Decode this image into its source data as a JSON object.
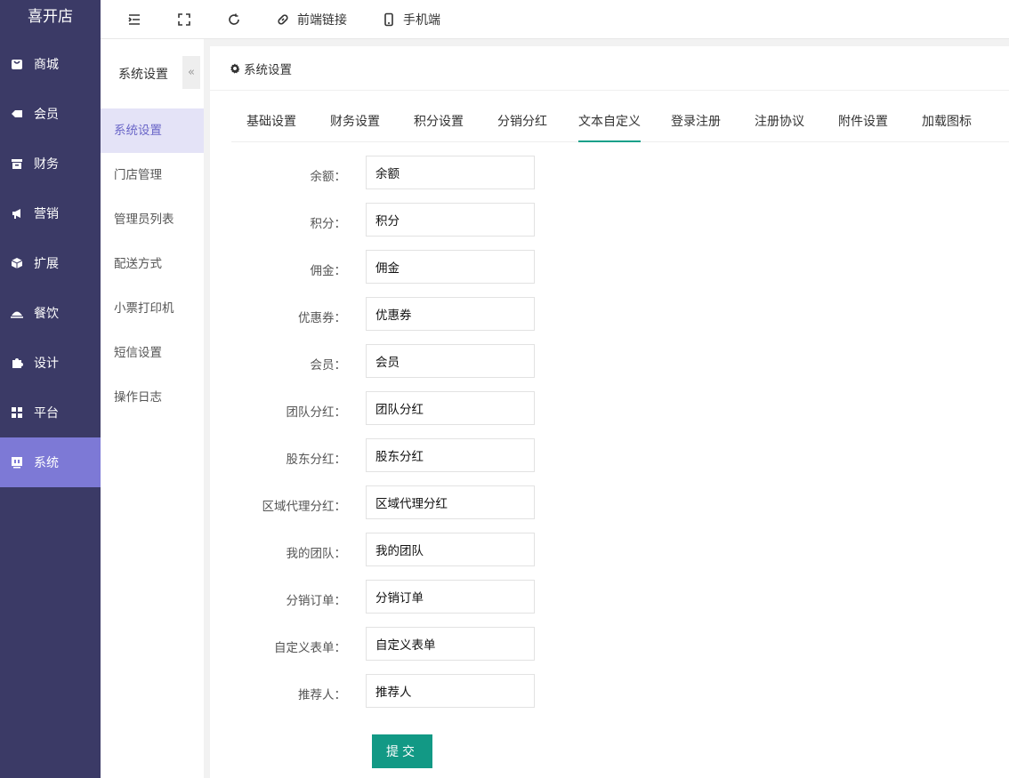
{
  "app": {
    "title": "喜开店"
  },
  "sidebar": {
    "items": [
      {
        "label": "商城",
        "icon": "shop-icon"
      },
      {
        "label": "会员",
        "icon": "tag-icon"
      },
      {
        "label": "财务",
        "icon": "archive-icon"
      },
      {
        "label": "营销",
        "icon": "megaphone-icon"
      },
      {
        "label": "扩展",
        "icon": "cube-icon"
      },
      {
        "label": "餐饮",
        "icon": "dish-icon"
      },
      {
        "label": "设计",
        "icon": "puzzle-icon"
      },
      {
        "label": "平台",
        "icon": "grid-icon"
      },
      {
        "label": "系统",
        "icon": "system-icon",
        "active": true
      }
    ]
  },
  "toolbar": {
    "frontend_link": "前端链接",
    "mobile": "手机端"
  },
  "subnav": {
    "title": "系统设置",
    "collapse": "«",
    "items": [
      {
        "label": "系统设置",
        "active": true
      },
      {
        "label": "门店管理"
      },
      {
        "label": "管理员列表"
      },
      {
        "label": "配送方式"
      },
      {
        "label": "小票打印机"
      },
      {
        "label": "短信设置"
      },
      {
        "label": "操作日志"
      }
    ]
  },
  "main": {
    "breadcrumb": "系统设置",
    "tabs": [
      "基础设置",
      "财务设置",
      "积分设置",
      "分销分红",
      "文本自定义",
      "登录注册",
      "注册协议",
      "附件设置",
      "加载图标"
    ],
    "active_tab": "文本自定义",
    "fields": [
      {
        "label": "余额：",
        "value": "余额"
      },
      {
        "label": "积分：",
        "value": "积分"
      },
      {
        "label": "佣金：",
        "value": "佣金"
      },
      {
        "label": "优惠券：",
        "value": "优惠券"
      },
      {
        "label": "会员：",
        "value": "会员"
      },
      {
        "label": "团队分红：",
        "value": "团队分红"
      },
      {
        "label": "股东分红：",
        "value": "股东分红"
      },
      {
        "label": "区域代理分红：",
        "value": "区域代理分红"
      },
      {
        "label": "我的团队：",
        "value": "我的团队"
      },
      {
        "label": "分销订单：",
        "value": "分销订单"
      },
      {
        "label": "自定义表单：",
        "value": "自定义表单"
      },
      {
        "label": "推荐人：",
        "value": "推荐人"
      }
    ],
    "submit_label": "提交"
  },
  "colors": {
    "sidebar_bg": "#3b3a66",
    "sidebar_active": "#7d79d6",
    "accent": "#15a08a",
    "submit_bg": "#129985"
  }
}
